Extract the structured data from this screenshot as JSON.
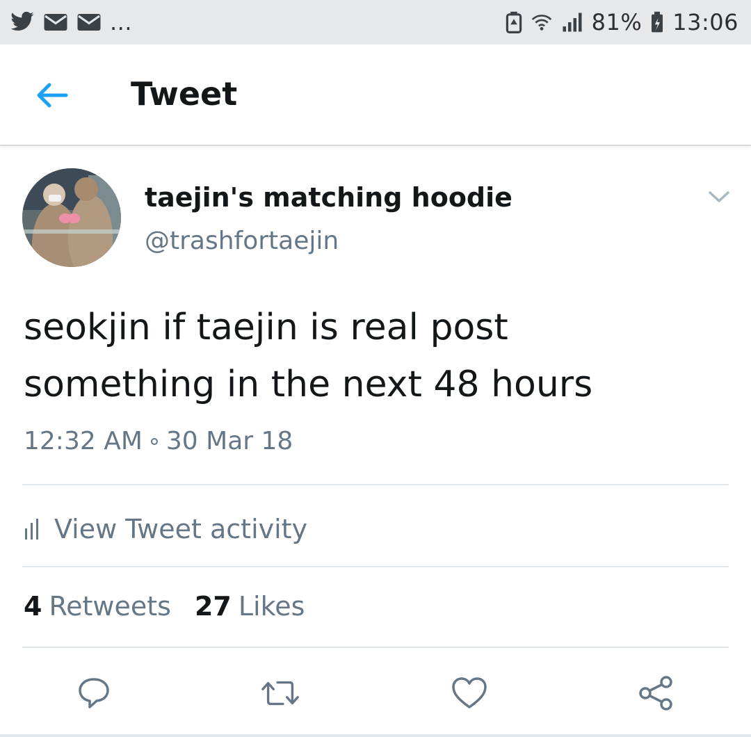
{
  "status_bar": {
    "overflow_label": "...",
    "battery_percent": "81%",
    "time": "13:06",
    "left_icons": [
      "twitter-bird-icon",
      "mail-icon",
      "mail-icon",
      "more-icon"
    ],
    "right_icons": [
      "battery-saver-icon",
      "wifi-icon",
      "signal-icon",
      "battery-icon"
    ]
  },
  "app_bar": {
    "title": "Tweet",
    "back_icon": "arrow-left-icon"
  },
  "tweet": {
    "author": {
      "display_name": "taejin's matching hoodie",
      "handle": "@trashfortaejin"
    },
    "text_line_1": "seokjin if taejin is real post",
    "text_line_2": "something in the next 48 hours",
    "time": "12:32 AM",
    "date": "30 Mar 18",
    "activity_label": "View Tweet activity",
    "retweets_count": "4",
    "retweets_label": "Retweets",
    "likes_count": "27",
    "likes_label": "Likes"
  },
  "actions": [
    "reply-icon",
    "retweet-icon",
    "like-icon",
    "share-icon"
  ],
  "colors": {
    "accent": "#1da1f2",
    "secondary_text": "#657786",
    "primary_text": "#14171a",
    "status_bar_bg": "#e6e8ea",
    "divider": "#e1e8ed"
  }
}
